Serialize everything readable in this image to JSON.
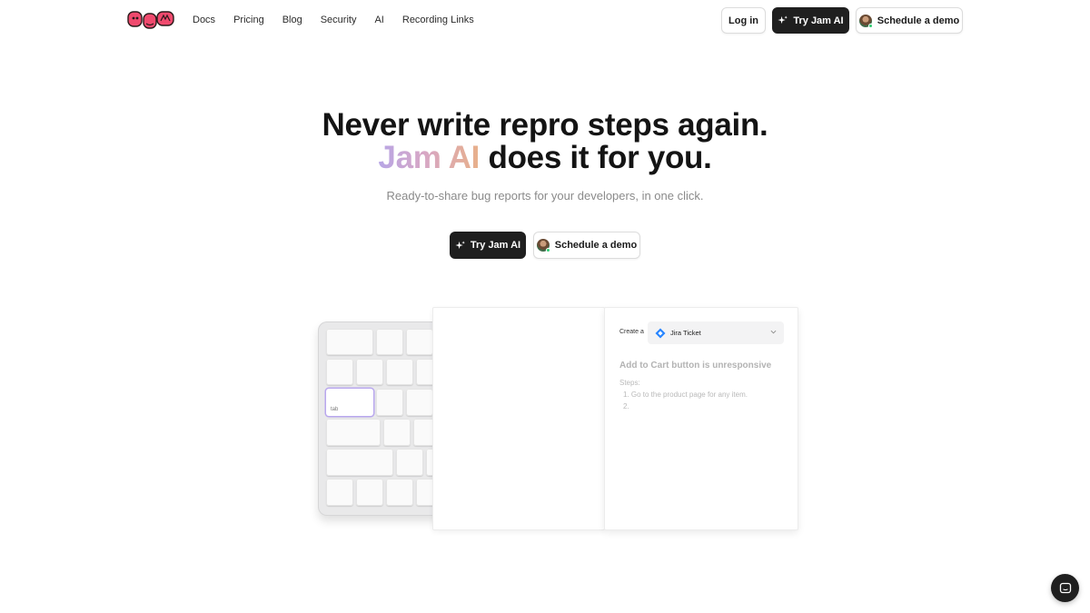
{
  "nav": {
    "logo_text": "JAM",
    "links": [
      "Docs",
      "Pricing",
      "Blog",
      "Security",
      "AI",
      "Recording Links"
    ],
    "login_label": "Log in",
    "try_label": "Try Jam AI",
    "demo_label": "Schedule a demo"
  },
  "hero": {
    "title_line1": "Never write repro steps again.",
    "title_accent": "Jam AI",
    "title_line2_rest": " does it for you.",
    "subtitle": "Ready-to-share bug reports for your developers, in one click.",
    "cta_primary": "Try Jam AI",
    "cta_secondary": "Schedule a demo"
  },
  "mockup": {
    "keyboard_tab_label": "tab",
    "create_label": "Create a",
    "ticket_type": "Jira Ticket",
    "issue_title": "Add to Cart button is unresponsive",
    "steps_label": "Steps:",
    "steps": [
      "1. Go to the product page for any item.",
      "2."
    ]
  },
  "colors": {
    "dark_button": "#1f1f1f",
    "accent_gradient_start": "#b7a6e6",
    "accent_gradient_end": "#e8b08a",
    "logo_pink": "#f04a6e"
  },
  "icons": {
    "chat": "chat-bubble-icon",
    "sparkle": "sparkle-icon",
    "jira": "jira-icon"
  }
}
